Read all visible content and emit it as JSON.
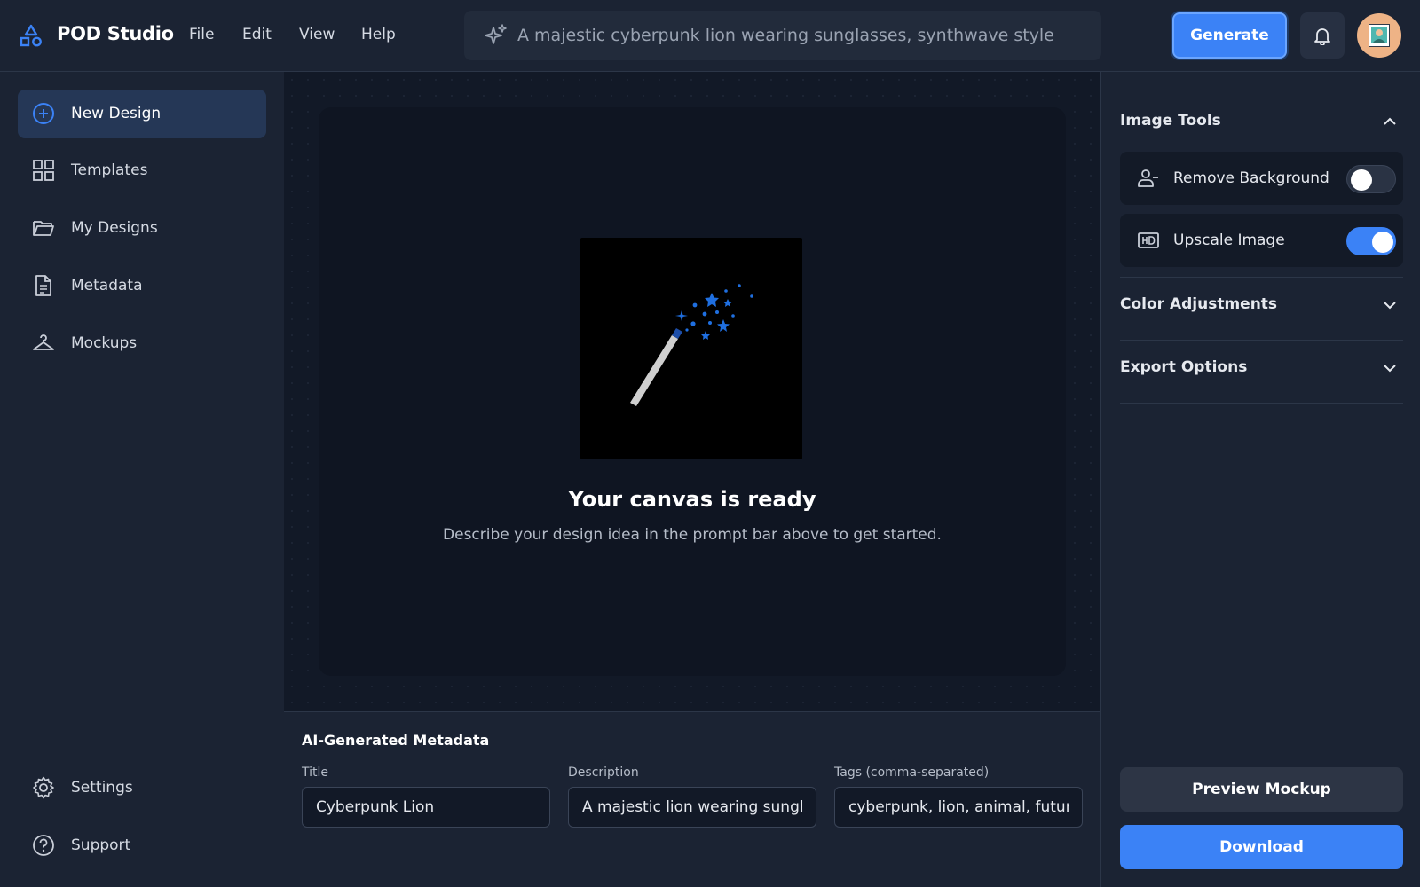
{
  "app": {
    "title": "POD Studio",
    "logo_icon": "shapes-icon",
    "accent_color": "#3b82f6"
  },
  "menu": [
    "File",
    "Edit",
    "View",
    "Help"
  ],
  "prompt": {
    "icon": "sparkles-icon",
    "value": "A majestic cyberpunk lion wearing sunglasses, synthwave style"
  },
  "header": {
    "generate_label": "Generate",
    "notification_icon": "bell-icon",
    "avatar_icon": "user-avatar-icon"
  },
  "sidebar": {
    "items": [
      {
        "label": "New Design",
        "icon": "plus-circle-icon",
        "active": true
      },
      {
        "label": "Templates",
        "icon": "grid-icon"
      },
      {
        "label": "My Designs",
        "icon": "folder-icon"
      },
      {
        "label": "Metadata",
        "icon": "document-icon"
      },
      {
        "label": "Mockups",
        "icon": "hanger-icon"
      }
    ],
    "bottom": [
      {
        "label": "Settings",
        "icon": "gear-icon"
      },
      {
        "label": "Support",
        "icon": "help-circle-icon"
      }
    ]
  },
  "canvas": {
    "illustration": "magic-wand-icon",
    "heading": "Your canvas is ready",
    "subtext": "Describe your design idea in the prompt bar above to get started."
  },
  "metadata": {
    "heading": "AI-Generated Metadata",
    "title": {
      "label": "Title",
      "value": "Cyberpunk Lion"
    },
    "description": {
      "label": "Description",
      "value": "A majestic lion wearing sunglasses in synthwave style"
    },
    "tags": {
      "label": "Tags (comma-separated)",
      "value": "cyberpunk, lion, animal, futuristic"
    }
  },
  "right_panel": {
    "image_tools": {
      "title": "Image Tools",
      "expanded": true,
      "tools": [
        {
          "label": "Remove Background",
          "icon": "user-minus-icon",
          "enabled": false
        },
        {
          "label": "Upscale Image",
          "icon": "hd-icon",
          "enabled": true
        }
      ]
    },
    "color_adjustments": {
      "title": "Color Adjustments",
      "expanded": false
    },
    "export_options": {
      "title": "Export Options",
      "expanded": false
    },
    "preview_label": "Preview Mockup",
    "download_label": "Download"
  }
}
